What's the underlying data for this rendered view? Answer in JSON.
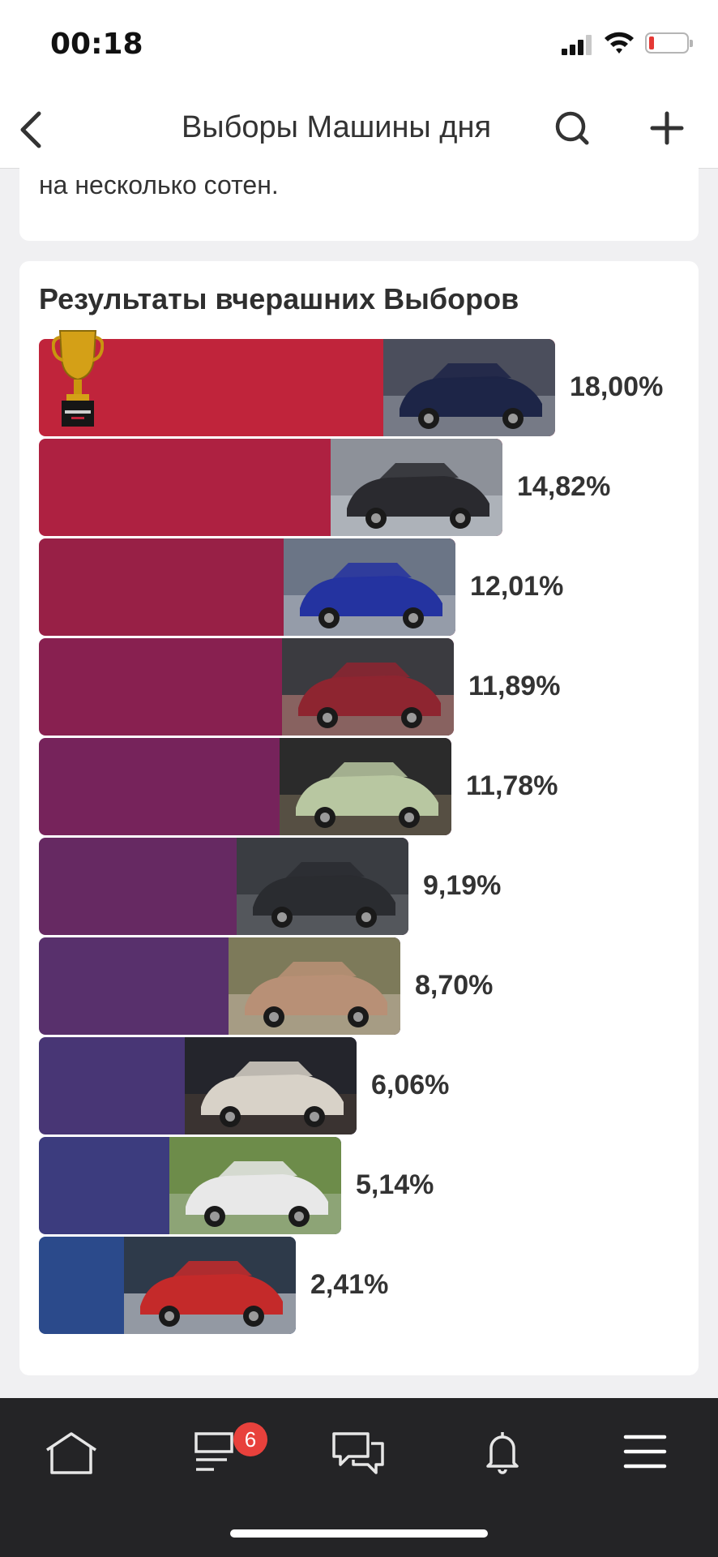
{
  "status": {
    "time": "00:18"
  },
  "nav": {
    "title": "Выборы Машины дня"
  },
  "previous_card": {
    "text": "на несколько сотен."
  },
  "results": {
    "title": "Результаты вчерашних Выборов",
    "items": [
      {
        "percent": "18,00%",
        "value": 18.0,
        "color": "#c0243b",
        "winner": true
      },
      {
        "percent": "14,82%",
        "value": 14.82,
        "color": "#ae2141",
        "winner": false
      },
      {
        "percent": "12,01%",
        "value": 12.01,
        "color": "#982046",
        "winner": false
      },
      {
        "percent": "11,89%",
        "value": 11.89,
        "color": "#882050",
        "winner": false
      },
      {
        "percent": "11,78%",
        "value": 11.78,
        "color": "#76235b",
        "winner": false
      },
      {
        "percent": "9,19%",
        "value": 9.19,
        "color": "#662962",
        "winner": false
      },
      {
        "percent": "8,70%",
        "value": 8.7,
        "color": "#58306c",
        "winner": false
      },
      {
        "percent": "6,06%",
        "value": 6.06,
        "color": "#483675",
        "winner": false
      },
      {
        "percent": "5,14%",
        "value": 5.14,
        "color": "#3c3c7e",
        "winner": false
      },
      {
        "percent": "2,41%",
        "value": 2.41,
        "color": "#2b4a8b",
        "winner": false
      }
    ]
  },
  "tabbar": {
    "badge_count": "6"
  }
}
